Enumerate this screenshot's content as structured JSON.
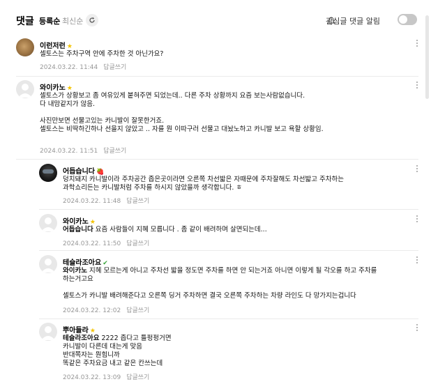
{
  "header": {
    "title": "댓글",
    "sort_registered": "등록순",
    "sort_newest": "최신순",
    "notify_label": "관심글 댓글 알림"
  },
  "comments": [
    {
      "nick": "이런저런",
      "badge": "★",
      "text": "셀토스는 주차구역 안에 주차한 것 아닌가요?",
      "date": "2024.03.22. 11:44",
      "reply": "답글쓰기"
    },
    {
      "nick": "와이카노",
      "badge": "★",
      "text": "셀토스가 상황보고 좀 여유있게 붙혀주면 되었는데.. 다른 주차 상황까지 요즘 보는사람없습니다.\n다 내맘같지가 않음.\n\n사진만보면 선물고있는 카니발이 잘못한거죠.\n셀토스는 비딱하긴하나 선을지 않았고 .. 자를 뭔 이따구러 선물고 대놨노하고 카니발 보고 욕할 상황임.",
      "date": "2024.03.22. 11:51",
      "reply": "답글쓰기"
    },
    {
      "nick": "어듭습니다",
      "badge": "🍓",
      "text": "덩치돼지 카니발이라 주차공간 좁은곳이라면 오른쪽 차선밟은 자때문에 주차잘해도 차선밟고 주차하는\n과학쇼리든는 카니발처럼 주차를 하시지 않았을까 생각합니다. ㅎ",
      "date": "2024.03.22. 11:48",
      "reply": "답글쓰기"
    },
    {
      "nick": "와이카노",
      "badge": "★",
      "mention": "어듭습니다",
      "text": " 요즘 사람들이 지혜 모릅니다 . 좀 같이 배려하며 살면되는데...",
      "date": "2024.03.22. 11:50",
      "reply": "답글쓰기"
    },
    {
      "nick": "테슬라조아요",
      "badge": "✔",
      "mention": "와이카노",
      "text": " 지혜 모르는게 아니고 주차선 밟을 정도면 주차를 하면 안 되는거죠 아니면 이렇게 될 각오를 하고 주차를\n하는거고요\n\n셀토스가 카니발 배려해준다고 오른쪽 딩거 주차하면 결국 오른쪽 주차하는 차량 라인도 다 망가지는겁니다",
      "date": "2024.03.22. 12:02",
      "reply": "답글쓰기"
    },
    {
      "nick": "뿌아들라",
      "badge": "★",
      "mention": "테슬라조아요",
      "text": " 2222 좁다고 틀펑펑거면\n카니발이 다른데 대는게 맞음\n반대쪽자는 뭔힘니까\n똑같은 주차요금 내고 같은 칸쓰는데",
      "date": "2024.03.22. 13:09",
      "reply": "답글쓰기"
    }
  ]
}
